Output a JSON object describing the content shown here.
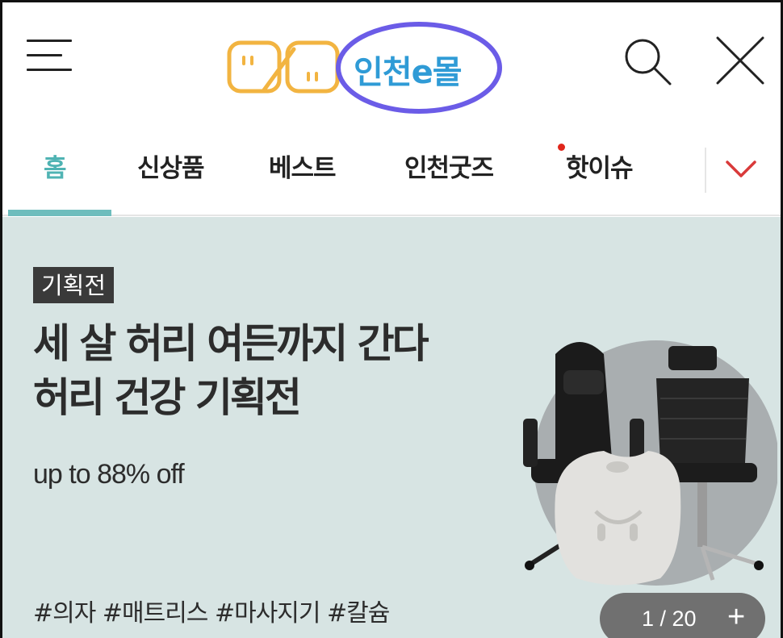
{
  "header": {
    "logo_text": "인천e몰",
    "menu_icon": "hamburger-menu-icon",
    "search_icon": "search-icon",
    "close_icon": "close-icon",
    "highlight_color": "#6b5ce7"
  },
  "tabs": {
    "items": [
      {
        "label": "홈",
        "active": true
      },
      {
        "label": "신상품",
        "active": false
      },
      {
        "label": "베스트",
        "active": false
      },
      {
        "label": "인천굿즈",
        "active": false
      },
      {
        "label": "핫이슈",
        "active": false,
        "new_dot": true
      }
    ],
    "more_icon": "chevron-down-icon",
    "active_color": "#4fb3b3",
    "dot_color": "#e0261b",
    "chevron_color": "#d93a3a"
  },
  "banner": {
    "badge": "기획전",
    "headline_line1": "세 살 허리 여든까지 간다",
    "headline_line2": "허리 건강 기획전",
    "discount": "up to 88% off",
    "tags": "#의자 #매트리스 #마사지기 #칼슘",
    "background_color": "#d7e4e3",
    "pager": {
      "count": "1 / 20",
      "plus": "+"
    }
  }
}
